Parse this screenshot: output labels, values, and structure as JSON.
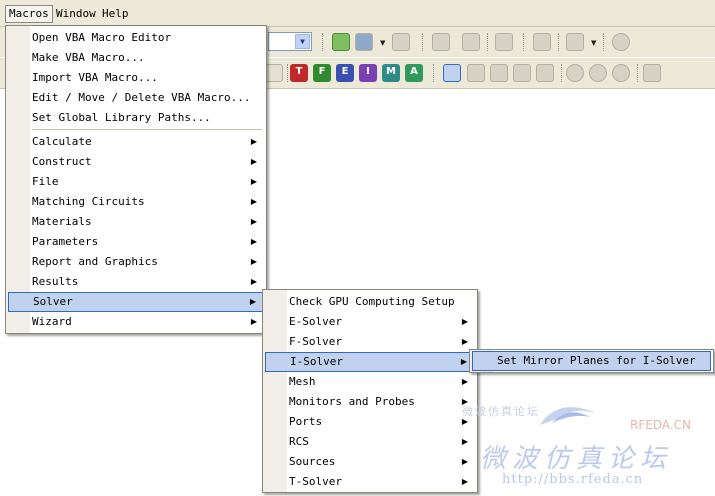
{
  "menubar": {
    "items": [
      {
        "label": "Macros",
        "active": true
      },
      {
        "label": "Window",
        "active": false
      },
      {
        "label": "Help",
        "active": false
      }
    ]
  },
  "toolbar2": {
    "letter_buttons": [
      {
        "letter": "T",
        "color": "#c0282a"
      },
      {
        "letter": "F",
        "color": "#2f8a2f"
      },
      {
        "letter": "E",
        "color": "#3a4fb0"
      },
      {
        "letter": "I",
        "color": "#7a3fb5"
      },
      {
        "letter": "M",
        "color": "#2f8a8a"
      },
      {
        "letter": "A",
        "color": "#2f9a5a"
      }
    ]
  },
  "macros_menu": {
    "items": [
      {
        "label": "Open VBA Macro Editor",
        "submenu": false
      },
      {
        "label": "Make VBA Macro...",
        "submenu": false
      },
      {
        "label": "Import VBA Macro...",
        "submenu": false
      },
      {
        "label": "Edit / Move / Delete VBA Macro...",
        "submenu": false
      },
      {
        "label": "Set Global Library Paths...",
        "submenu": false
      },
      {
        "label": "Calculate",
        "submenu": true
      },
      {
        "label": "Construct",
        "submenu": true
      },
      {
        "label": "File",
        "submenu": true
      },
      {
        "label": "Matching Circuits",
        "submenu": true
      },
      {
        "label": "Materials",
        "submenu": true
      },
      {
        "label": "Parameters",
        "submenu": true
      },
      {
        "label": "Report and Graphics",
        "submenu": true
      },
      {
        "label": "Results",
        "submenu": true
      },
      {
        "label": "Solver",
        "submenu": true,
        "highlighted": true
      },
      {
        "label": "Wizard",
        "submenu": true
      }
    ]
  },
  "solver_menu": {
    "items": [
      {
        "label": "Check GPU Computing Setup",
        "submenu": false
      },
      {
        "label": "E-Solver",
        "submenu": true
      },
      {
        "label": "F-Solver",
        "submenu": true
      },
      {
        "label": "I-Solver",
        "submenu": true,
        "highlighted": true
      },
      {
        "label": "Mesh",
        "submenu": true
      },
      {
        "label": "Monitors and Probes",
        "submenu": true
      },
      {
        "label": "Ports",
        "submenu": true
      },
      {
        "label": "RCS",
        "submenu": true
      },
      {
        "label": "Sources",
        "submenu": true
      },
      {
        "label": "T-Solver",
        "submenu": true
      }
    ]
  },
  "isolver_menu": {
    "items": [
      {
        "label": "Set Mirror Planes for I-Solver",
        "submenu": false,
        "highlighted": true
      }
    ]
  },
  "watermark": {
    "brand": "RFEDA.CN",
    "top_text": "微波仿真论坛",
    "cn_text": "微波仿真论坛",
    "url": "http://bbs.rfeda.cn"
  },
  "icons": {
    "arrow": "▶",
    "dropdown": "▼"
  }
}
